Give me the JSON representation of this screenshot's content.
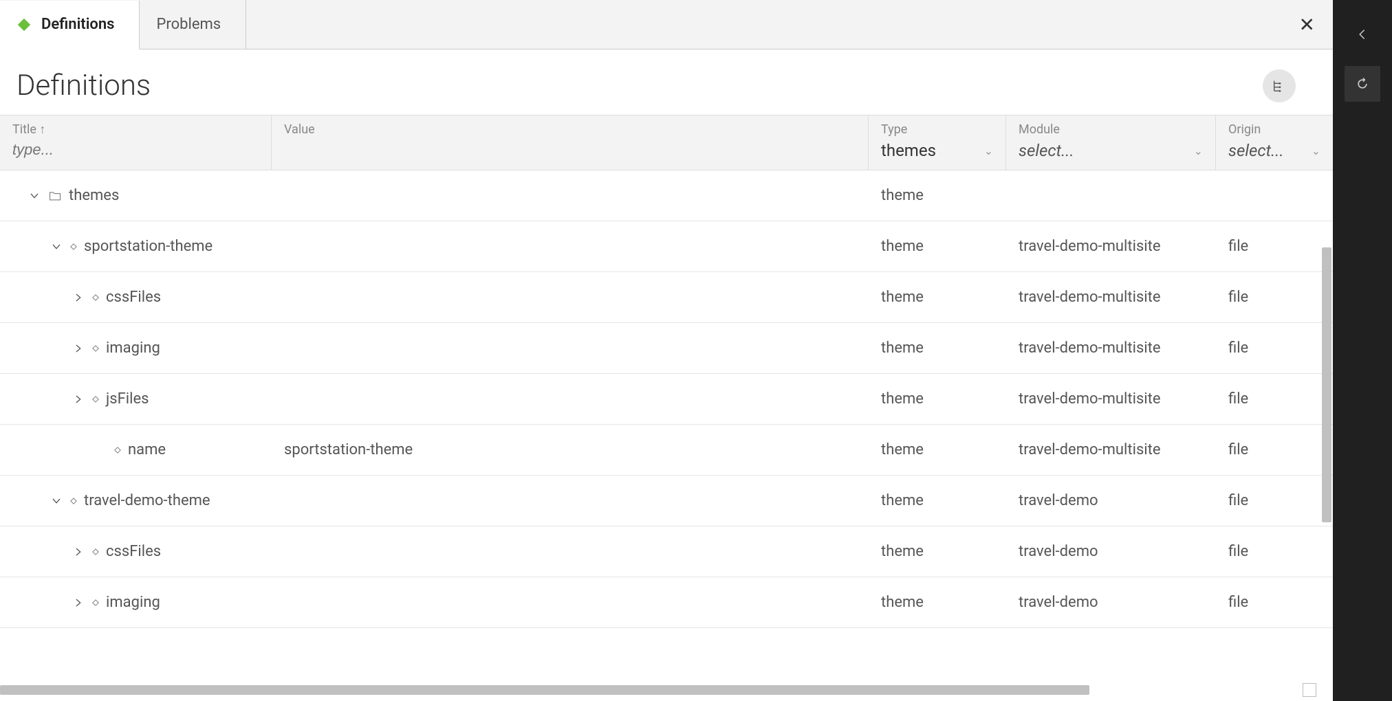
{
  "tabs": {
    "definitions": "Definitions",
    "problems": "Problems"
  },
  "page_title": "Definitions",
  "columns": {
    "title": "Title",
    "value": "Value",
    "type": "Type",
    "module": "Module",
    "origin": "Origin"
  },
  "filters": {
    "title_placeholder": "type...",
    "type_value": "themes",
    "module_placeholder": "select...",
    "origin_placeholder": "select..."
  },
  "rows": [
    {
      "title": "themes",
      "value": "",
      "type": "theme",
      "module": "",
      "origin": "",
      "indent": 0,
      "expand": "down",
      "icon": "folder"
    },
    {
      "title": "sportstation-theme",
      "value": "",
      "type": "theme",
      "module": "travel-demo-multisite",
      "origin": "file",
      "indent": 1,
      "expand": "down",
      "icon": "item"
    },
    {
      "title": "cssFiles",
      "value": "",
      "type": "theme",
      "module": "travel-demo-multisite",
      "origin": "file",
      "indent": 2,
      "expand": "right",
      "icon": "item"
    },
    {
      "title": "imaging",
      "value": "",
      "type": "theme",
      "module": "travel-demo-multisite",
      "origin": "file",
      "indent": 2,
      "expand": "right",
      "icon": "item"
    },
    {
      "title": "jsFiles",
      "value": "",
      "type": "theme",
      "module": "travel-demo-multisite",
      "origin": "file",
      "indent": 2,
      "expand": "right",
      "icon": "item"
    },
    {
      "title": "name",
      "value": "sportstation-theme",
      "type": "theme",
      "module": "travel-demo-multisite",
      "origin": "file",
      "indent": 3,
      "expand": "none",
      "icon": "item"
    },
    {
      "title": "travel-demo-theme",
      "value": "",
      "type": "theme",
      "module": "travel-demo",
      "origin": "file",
      "indent": 1,
      "expand": "down",
      "icon": "item"
    },
    {
      "title": "cssFiles",
      "value": "",
      "type": "theme",
      "module": "travel-demo",
      "origin": "file",
      "indent": 2,
      "expand": "right",
      "icon": "item"
    },
    {
      "title": "imaging",
      "value": "",
      "type": "theme",
      "module": "travel-demo",
      "origin": "file",
      "indent": 2,
      "expand": "right",
      "icon": "item"
    }
  ]
}
